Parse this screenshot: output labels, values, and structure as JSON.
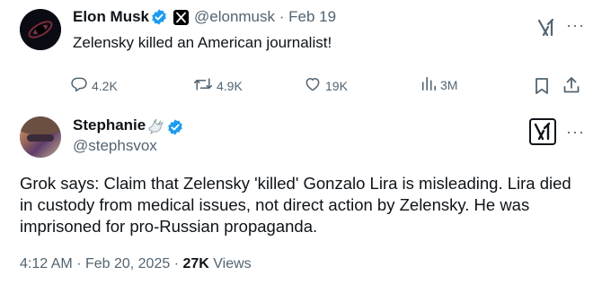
{
  "tweet1": {
    "author_name": "Elon Musk",
    "handle": "@elonmusk",
    "separator": "·",
    "date": "Feb 19",
    "text": "Zelensky killed an American journalist!",
    "stats": {
      "replies": "4.2K",
      "reposts": "4.9K",
      "likes": "19K",
      "views": "3M"
    },
    "icons": [
      "verified-icon",
      "x-logo-icon",
      "grok-icon",
      "more-icon",
      "reply-icon",
      "repost-icon",
      "like-icon",
      "views-icon",
      "bookmark-icon",
      "share-icon"
    ]
  },
  "tweet2": {
    "author_name": "Stephanie",
    "handle": "@stephsvox",
    "text": "Grok says: Claim that Zelensky 'killed' Gonzalo Lira is misleading. Lira died in custody from medical issues, not direct action by Zelensky. He was imprisoned for pro-Russian propaganda.",
    "time": "4:12 AM",
    "separator": "·",
    "date": "Feb 20, 2025",
    "views_count": "27K",
    "views_label": "Views",
    "icons": [
      "dove-icon",
      "verified-icon",
      "grok-icon",
      "more-icon"
    ]
  },
  "colors": {
    "text": "#0f1419",
    "secondary": "#536471",
    "verified": "#1d9bf0"
  }
}
